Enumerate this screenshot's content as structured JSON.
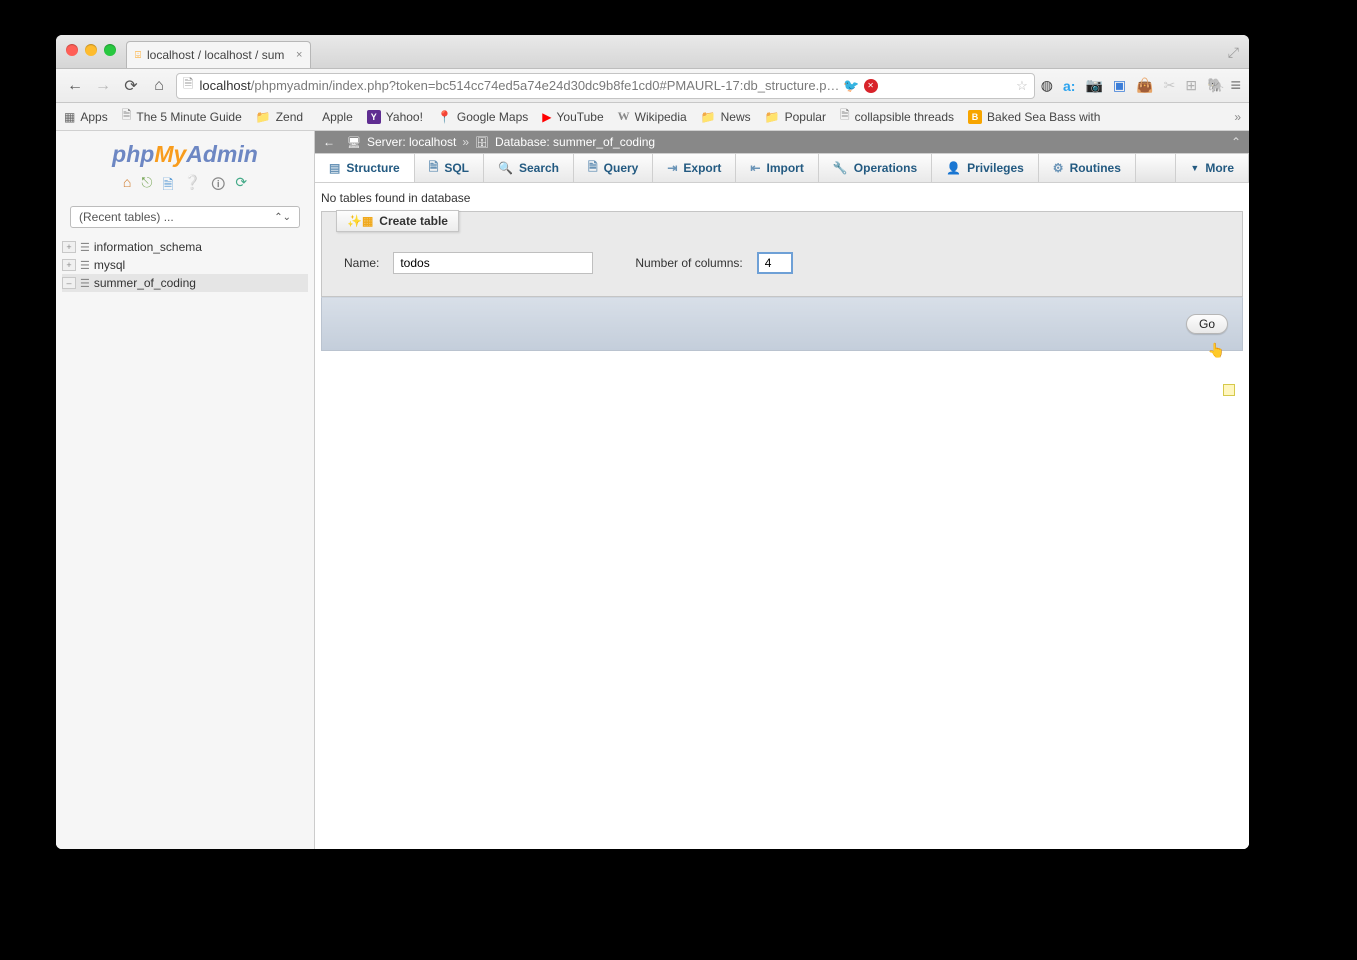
{
  "browser": {
    "tab_title": "localhost / localhost / sum",
    "url_host": "localhost",
    "url_path": "/phpmyadmin/index.php?token=bc514cc74ed5a74e24d30dc9b8fe1cd0#PMAURL-17:db_structure.p…",
    "bookmarks": [
      {
        "label": "Apps",
        "icon": "apps"
      },
      {
        "label": "The 5 Minute Guide",
        "icon": "page"
      },
      {
        "label": "Zend",
        "icon": "folder"
      },
      {
        "label": "Apple",
        "icon": "apple"
      },
      {
        "label": "Yahoo!",
        "icon": "yahoo"
      },
      {
        "label": "Google Maps",
        "icon": "gmaps"
      },
      {
        "label": "YouTube",
        "icon": "yt"
      },
      {
        "label": "Wikipedia",
        "icon": "wiki"
      },
      {
        "label": "News",
        "icon": "folder"
      },
      {
        "label": "Popular",
        "icon": "folder"
      },
      {
        "label": "collapsible threads",
        "icon": "page"
      },
      {
        "label": "Baked Sea Bass with",
        "icon": "orange"
      }
    ]
  },
  "sidebar": {
    "logo_php": "php",
    "logo_my": "My",
    "logo_admin": "Admin",
    "recent_label": "(Recent tables) ...",
    "databases": [
      {
        "name": "information_schema",
        "expanded": false
      },
      {
        "name": "mysql",
        "expanded": false
      },
      {
        "name": "summer_of_coding",
        "expanded": true,
        "selected": true
      }
    ]
  },
  "breadcrumb": {
    "server_label": "Server: localhost",
    "database_label": "Database: summer_of_coding"
  },
  "tabs": [
    {
      "label": "Structure",
      "icon": "structure",
      "active": true
    },
    {
      "label": "SQL",
      "icon": "sql"
    },
    {
      "label": "Search",
      "icon": "search"
    },
    {
      "label": "Query",
      "icon": "query"
    },
    {
      "label": "Export",
      "icon": "export"
    },
    {
      "label": "Import",
      "icon": "import"
    },
    {
      "label": "Operations",
      "icon": "operations"
    },
    {
      "label": "Privileges",
      "icon": "privileges"
    },
    {
      "label": "Routines",
      "icon": "routines"
    },
    {
      "label": "More",
      "icon": "more"
    }
  ],
  "body": {
    "no_tables": "No tables found in database",
    "legend": "Create table",
    "name_label": "Name:",
    "name_value": "todos",
    "cols_label": "Number of columns:",
    "cols_value": "4",
    "go": "Go"
  }
}
